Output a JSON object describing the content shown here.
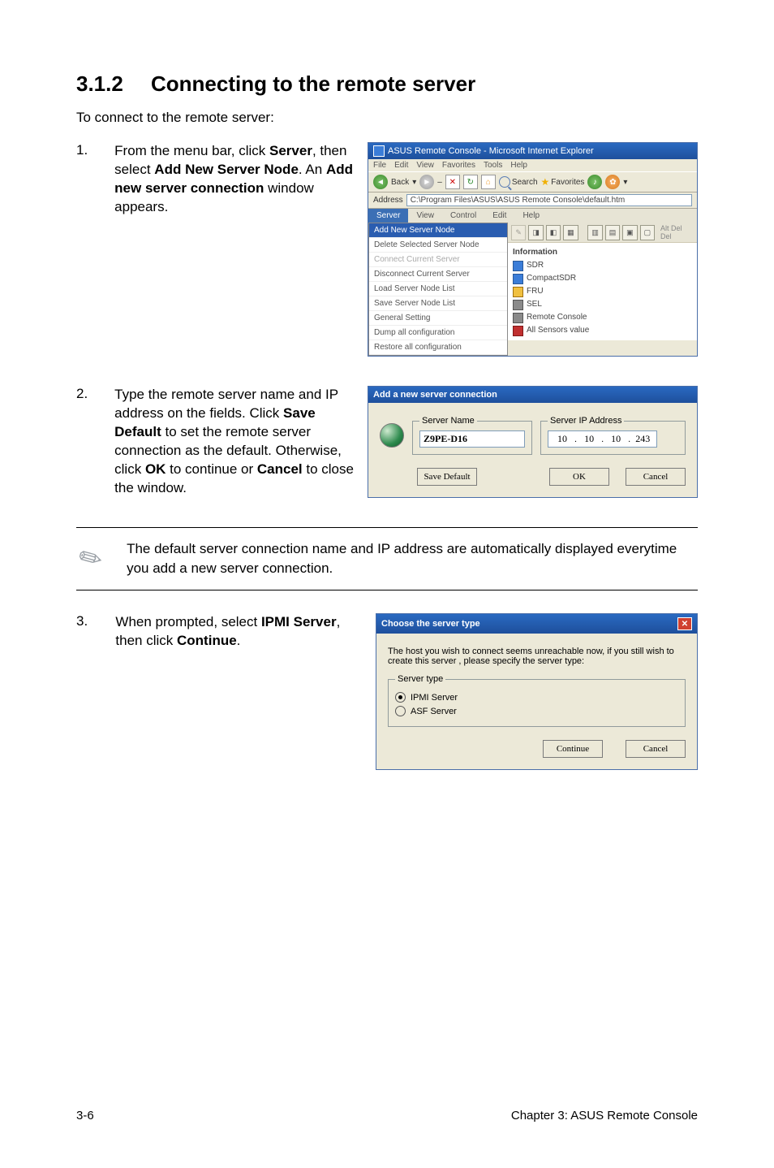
{
  "heading": {
    "num": "3.1.2",
    "title": "Connecting to the remote server"
  },
  "lead": "To connect to the remote server:",
  "steps": {
    "s1": {
      "no": "1.",
      "t": [
        "From the menu bar, click ",
        "Server",
        ", then select ",
        "Add New Server Node",
        ". An ",
        "Add new server connection",
        " window appears."
      ]
    },
    "s2": {
      "no": "2.",
      "t": [
        "Type the remote server name and IP address on the fields. Click ",
        "Save Default",
        " to set the remote server connection as the default. Otherwise, click ",
        "OK",
        " to continue or ",
        "Cancel",
        " to close the window."
      ]
    },
    "s3": {
      "no": "3.",
      "t": [
        "When prompted, select ",
        "IPMI Server",
        ", then click ",
        "Continue",
        "."
      ]
    }
  },
  "ie": {
    "title": "ASUS Remote Console - Microsoft Internet Explorer",
    "menu": [
      "File",
      "Edit",
      "View",
      "Favorites",
      "Tools",
      "Help"
    ],
    "back": "Back",
    "search": "Search",
    "fav": "Favorites",
    "addr_label": "Address",
    "addr": "C:\\Program Files\\ASUS\\ASUS Remote Console\\default.htm",
    "app_menu": [
      "Server",
      "View",
      "Control",
      "Edit",
      "Help"
    ],
    "dd": [
      "Add New Server Node",
      "Delete Selected Server Node",
      "Connect Current Server",
      "Disconnect Current Server",
      "Load Server Node List",
      "Save Server Node List",
      "General Setting",
      "Dump all configuration",
      "Restore all configuration"
    ],
    "tree_title": "Information",
    "tree": [
      "SDR",
      "CompactSDR",
      "FRU",
      "SEL",
      "Remote Console",
      "All Sensors value"
    ],
    "tb_tail": "Alt Del Del"
  },
  "add": {
    "title": "Add a new server connection",
    "name_legend": "Server Name",
    "name_value": "Z9PE-D16",
    "ip_legend": "Server IP Address",
    "ip": [
      "10",
      "10",
      "10",
      "243"
    ],
    "save": "Save Default",
    "ok": "OK",
    "cancel": "Cancel"
  },
  "note": "The default server connection name and IP address are automatically displayed everytime you add a new server connection.",
  "choose": {
    "title": "Choose the server type",
    "msg": "The host you wish to connect seems unreachable now, if you still wish to create this server , please specify the server type:",
    "legend": "Server type",
    "r1": "IPMI Server",
    "r2": "ASF Server",
    "cont": "Continue",
    "cancel": "Cancel"
  },
  "footer": {
    "left": "3-6",
    "right": "Chapter 3: ASUS Remote Console"
  }
}
